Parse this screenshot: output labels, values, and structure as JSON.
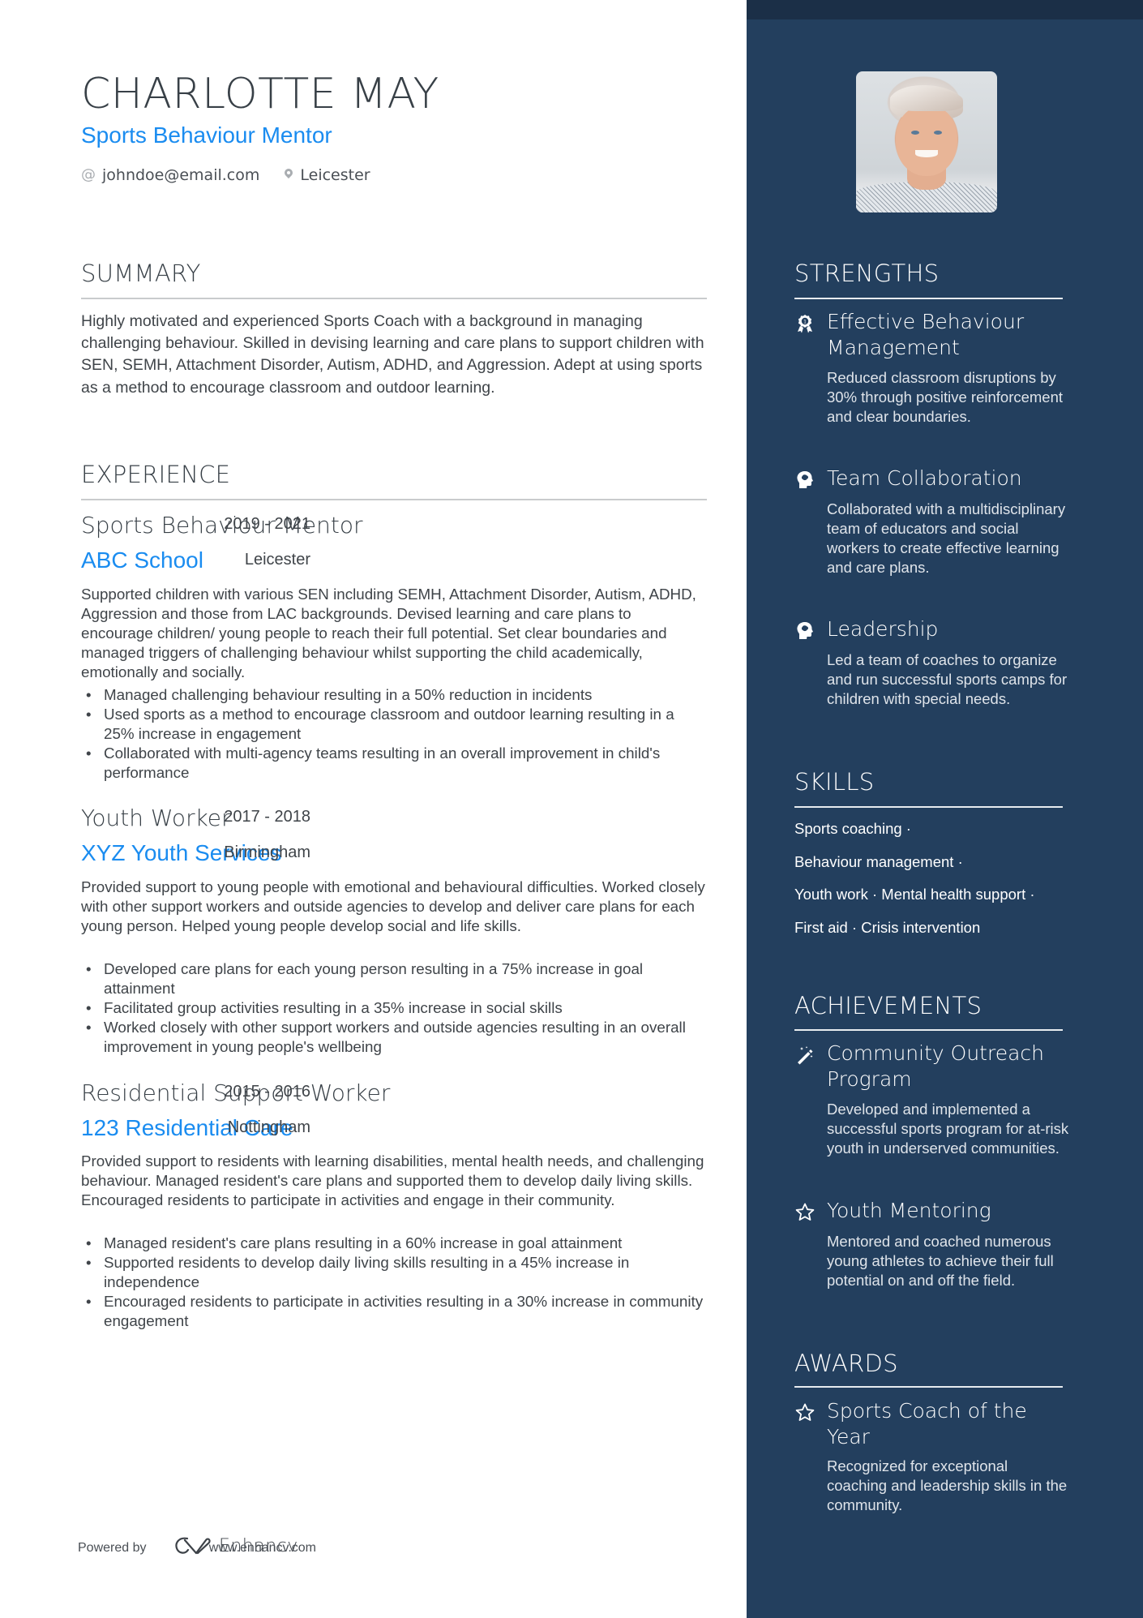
{
  "header": {
    "name": "CHARLOTTE MAY",
    "title": "Sports Behaviour Mentor",
    "email_icon": "at-icon",
    "email": "johndoe@email.com",
    "location_icon": "map-pin-icon",
    "location": "Leicester"
  },
  "summary": {
    "heading": "SUMMARY",
    "text": "Highly motivated and experienced Sports Coach with a background in managing challenging behaviour. Skilled in devising learning and care plans to support children with SEN, SEMH, Attachment Disorder, Autism, ADHD, and Aggression. Adept at using sports as a method to encourage classroom and outdoor learning."
  },
  "experience": {
    "heading": "EXPERIENCE",
    "jobs": [
      {
        "title": "Sports Behaviour Mentor",
        "dates": "2019 - 2021",
        "company": "ABC School",
        "location": "Leicester",
        "description": "Supported children with various SEN including SEMH, Attachment Disorder, Autism, ADHD, Aggression and those from LAC backgrounds. Devised learning and care plans to encourage children/ young people to reach their full potential. Set clear boundaries and managed triggers of challenging behaviour whilst supporting the child academically, emotionally and socially.",
        "bullets": [
          "Managed challenging behaviour resulting in a 50% reduction in incidents",
          "Used sports as a method to encourage classroom and outdoor learning resulting in a 25% increase in engagement",
          "Collaborated with multi-agency teams resulting in an overall improvement in child's performance"
        ]
      },
      {
        "title": "Youth Worker",
        "dates": "2017 - 2018",
        "company": "XYZ Youth Services",
        "location": "Birmingham",
        "description": "Provided support to young people with emotional and behavioural difficulties. Worked closely with other support workers and outside agencies to develop and deliver care plans for each young person. Helped young people develop social and life skills.",
        "bullets": [
          "Developed care plans for each young person resulting in a 75% increase in goal attainment",
          "Facilitated group activities resulting in a 35% increase in social skills",
          "Worked closely with other support workers and outside agencies resulting in an overall improvement in young people's wellbeing"
        ]
      },
      {
        "title": "Residential Support Worker",
        "dates": "2015 - 2016",
        "company": "123 Residential Care",
        "location": "Nottingham",
        "description": "Provided support to residents with learning disabilities, mental health needs, and challenging behaviour. Managed resident's care plans and supported them to develop daily living skills. Encouraged residents to participate in activities and engage in their community.",
        "bullets": [
          "Managed resident's care plans resulting in a 60% increase in goal attainment",
          "Supported residents to develop daily living skills resulting in a 45% increase in independence",
          "Encouraged residents to participate in activities resulting in a 30% increase in community engagement"
        ]
      }
    ]
  },
  "footer": {
    "powered_by": "Powered by",
    "brand": "Enhancv",
    "url": "www.enhancv.com"
  },
  "sidebar": {
    "photo_alt": "Profile photo",
    "strengths": {
      "heading": "STRENGTHS",
      "items": [
        {
          "icon": "award-medal-icon",
          "title": "Effective Behaviour Management",
          "description": "Reduced classroom disruptions by 30% through positive reinforcement and clear boundaries."
        },
        {
          "icon": "head-brain-icon",
          "title": "Team Collaboration",
          "description": "Collaborated with a multidisciplinary team of educators and social workers to create effective learning and care plans."
        },
        {
          "icon": "head-brain-icon",
          "title": "Leadership",
          "description": "Led a team of coaches to organize and run successful sports camps for children with special needs."
        }
      ]
    },
    "skills": {
      "heading": "SKILLS",
      "lines": [
        "Sports coaching ·",
        "Behaviour management ·",
        "Youth work · Mental health support ·",
        "First aid · Crisis intervention"
      ]
    },
    "achievements": {
      "heading": "ACHIEVEMENTS",
      "items": [
        {
          "icon": "magic-wand-icon",
          "title": "Community Outreach Program",
          "description": "Developed and implemented a successful sports program for at-risk youth in underserved communities."
        },
        {
          "icon": "star-icon",
          "title": "Youth Mentoring",
          "description": "Mentored and coached numerous young athletes to achieve their full potential on and off the field."
        }
      ]
    },
    "awards": {
      "heading": "AWARDS",
      "items": [
        {
          "icon": "star-icon",
          "title": "Sports Coach of the Year",
          "description": "Recognized for exceptional coaching and leadership skills in the community."
        }
      ]
    }
  },
  "colors": {
    "accent": "#1a8cf0",
    "sidebar": "#233f5e",
    "sidebar_top": "#1b2f47",
    "text": "#3f4449"
  }
}
